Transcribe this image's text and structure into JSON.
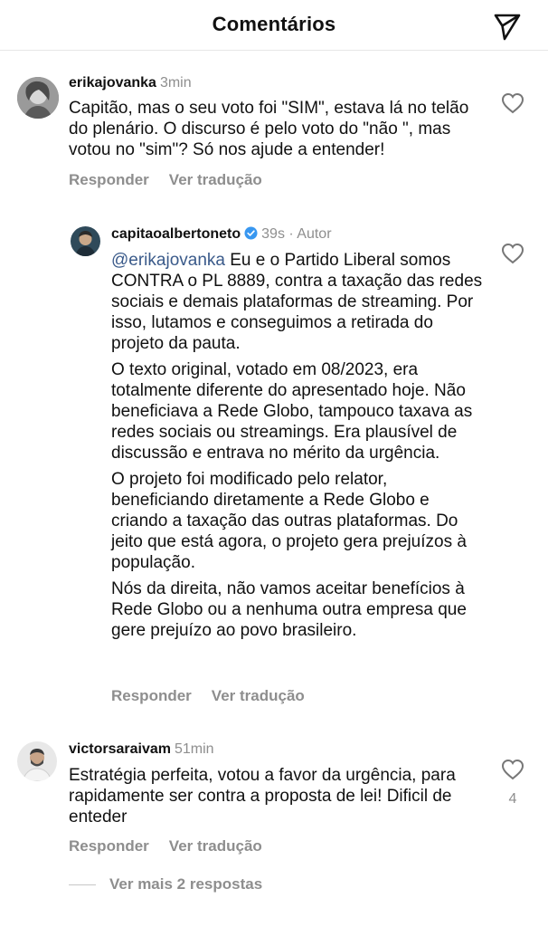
{
  "header": {
    "title": "Comentários",
    "share_icon": "paper-plane-icon"
  },
  "comments": [
    {
      "username": "erikajovanka",
      "time": "3min",
      "text": "Capitão, mas o seu voto foi \"SIM\", estava lá no telão do plenário. O discurso é pelo voto do \"não \", mas votou no \"sim\"? Só nos ajude a entender!",
      "reply_label": "Responder",
      "translate_label": "Ver tradução"
    },
    {
      "username": "capitaoalbertoneto",
      "verified": true,
      "time": "39s",
      "author_label": "· Autor",
      "mention": "@erikajovanka",
      "paragraphs": [
        " Eu e o Partido Liberal somos CONTRA o PL 8889, contra a taxação das redes sociais e demais plataformas de streaming. Por isso, lutamos e conseguimos a retirada do projeto da pauta.",
        "O texto original, votado em 08/2023, era totalmente diferente do apresentado hoje. Não beneficiava a Rede Globo, tampouco taxava as redes sociais ou streamings. Era plausível de discussão e entrava no mérito da urgência.",
        "O projeto foi modificado pelo relator, beneficiando diretamente a Rede Globo e criando a taxação das outras plataformas. Do jeito que está agora, o projeto gera prejuízos à população.",
        "Nós da direita, não vamos aceitar benefícios à Rede Globo ou a nenhuma outra empresa que gere prejuízo ao povo brasileiro."
      ],
      "reply_label": "Responder",
      "translate_label": "Ver tradução"
    },
    {
      "username": "victorsaraivam",
      "time": "51min",
      "text": "Estratégia perfeita, votou a favor da urgência, para rapidamente ser contra a proposta de lei! Dificil de enteder",
      "likes": "4",
      "reply_label": "Responder",
      "translate_label": "Ver tradução",
      "more_replies": "Ver mais 2 respostas"
    }
  ]
}
